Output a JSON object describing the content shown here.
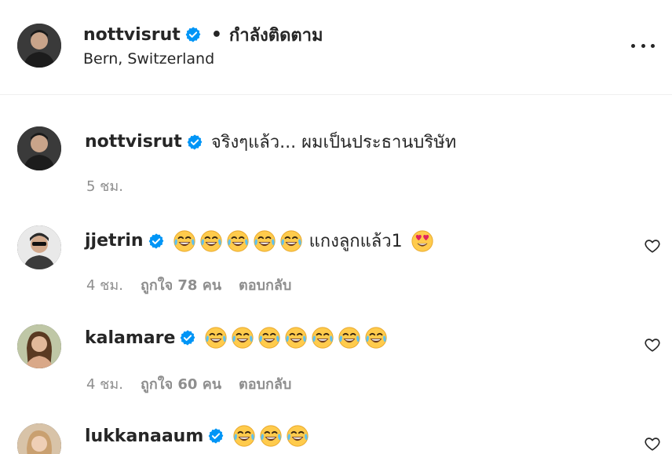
{
  "header": {
    "username": "nottvisrut",
    "separator": "•",
    "follow_status": "กำลังติดตาม",
    "location": "Bern, Switzerland"
  },
  "caption": {
    "username": "nottvisrut",
    "text": "จริงๆแล้ว... ผมเป็นประธานบริษัท",
    "time": "5 ชม."
  },
  "comments": [
    {
      "username": "jjetrin",
      "text": "แกงลูกแล้ว1",
      "emoji_before": [
        "face-with-tears-of-joy",
        "face-with-tears-of-joy",
        "face-with-tears-of-joy",
        "face-with-tears-of-joy",
        "face-with-tears-of-joy"
      ],
      "emoji_after": [
        "smiling-face-with-heart-eyes"
      ],
      "time": "4 ชม.",
      "likes": "ถูกใจ 78 คน",
      "reply": "ตอบกลับ"
    },
    {
      "username": "kalamare",
      "text": "",
      "emoji_before": [
        "face-with-tears-of-joy",
        "face-with-tears-of-joy",
        "face-with-tears-of-joy",
        "face-with-tears-of-joy",
        "face-with-tears-of-joy",
        "face-with-tears-of-joy",
        "face-with-tears-of-joy"
      ],
      "time": "4 ชม.",
      "likes": "ถูกใจ 60 คน",
      "reply": "ตอบกลับ"
    },
    {
      "username": "lukkanaaum",
      "text": "",
      "emoji_before": [
        "face-with-tears-of-joy",
        "face-with-tears-of-joy",
        "face-with-tears-of-joy"
      ]
    }
  ],
  "colors": {
    "text": "#262626",
    "secondary": "#8e8e8e",
    "verified_blue": "#0095f6",
    "divider": "#efefef"
  },
  "icons": {
    "verified": "verified-badge-icon",
    "more": "more-options-icon",
    "heart": "heart-outline-icon"
  }
}
